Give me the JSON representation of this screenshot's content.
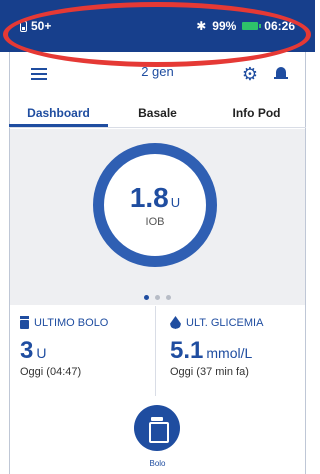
{
  "status_bar": {
    "pod_status": "50+",
    "battery": "99%",
    "time": "06:26",
    "battery_color": "#2ec26a",
    "background": "#173f8c"
  },
  "header": {
    "device_name": "2 gen",
    "icons": [
      "menu-icon",
      "gear-icon",
      "bell-icon"
    ]
  },
  "tabs": [
    {
      "label": "Dashboard",
      "active": true
    },
    {
      "label": "Basale",
      "active": false
    },
    {
      "label": "Info Pod",
      "active": false
    }
  ],
  "iob": {
    "value": "1.8",
    "unit": "U",
    "label": "IOB"
  },
  "pager": {
    "pages": 3,
    "current": 1
  },
  "cards": {
    "last_bolus": {
      "title": "ULTIMO BOLO",
      "value": "3",
      "unit": "U",
      "time": "Oggi (04:47)"
    },
    "last_glucose": {
      "title": "ULT. GLICEMIA",
      "value": "5.1",
      "unit": "mmol/L",
      "time": "Oggi (37 min fa)"
    }
  },
  "bolus_button": {
    "label": "Bolo"
  },
  "colors": {
    "accent": "#1f4da0",
    "annotation": "#e53935"
  }
}
